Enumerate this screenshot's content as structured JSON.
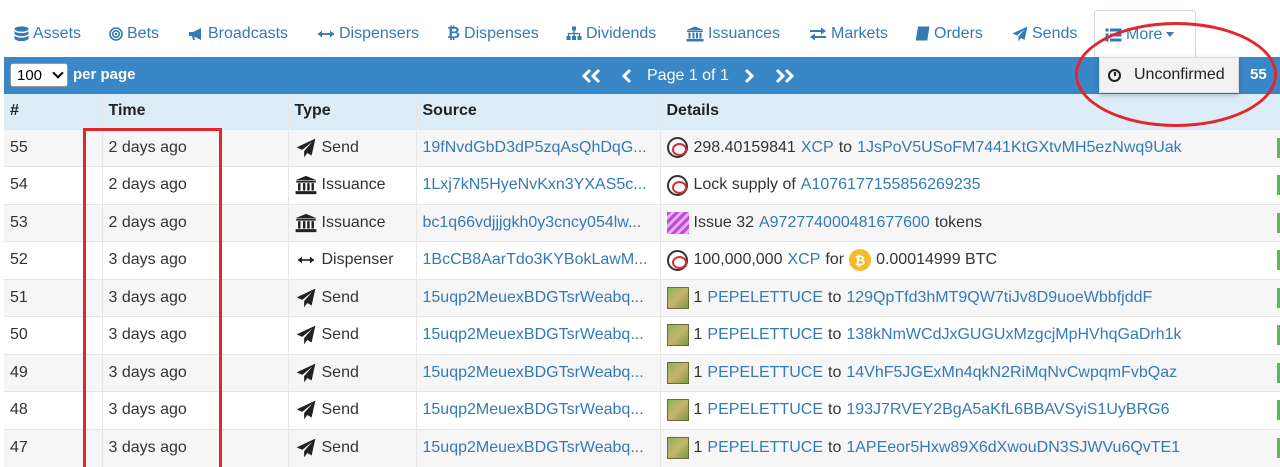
{
  "nav": {
    "items": [
      {
        "label": "Assets",
        "icon": "database-icon"
      },
      {
        "label": "Bets",
        "icon": "bullseye-icon"
      },
      {
        "label": "Broadcasts",
        "icon": "bullhorn-icon"
      },
      {
        "label": "Dispensers",
        "icon": "arrows-h-icon"
      },
      {
        "label": "Dispenses",
        "icon": "bitcoin-icon"
      },
      {
        "label": "Dividends",
        "icon": "sitemap-icon"
      },
      {
        "label": "Issuances",
        "icon": "bank-icon"
      },
      {
        "label": "Markets",
        "icon": "exchange-icon"
      },
      {
        "label": "Orders",
        "icon": "book-icon"
      },
      {
        "label": "Sends",
        "icon": "paper-plane-icon"
      },
      {
        "label": "More",
        "icon": "list-icon"
      }
    ]
  },
  "toolbar": {
    "per_page_value": "100",
    "per_page_label": "per page",
    "page_text": "Page 1 of 1",
    "count": "55"
  },
  "dropdown": {
    "item": "Unconfirmed",
    "icon": "clock-icon"
  },
  "table": {
    "headers": [
      "#",
      "Time",
      "Type",
      "Source",
      "Details"
    ],
    "rows": [
      {
        "n": "55",
        "time": "2 days ago",
        "type": "Send",
        "type_icon": "paper-plane-icon",
        "source": "19fNvdGbD3dP5zqAsQhDqG...",
        "icon": "xcp",
        "pre": "298.40159841",
        "asset": "XCP",
        "mid": "to",
        "link2": "1JsPoV5USoFM7441KtGXtvMH5ezNwq9Uak",
        "post": ""
      },
      {
        "n": "54",
        "time": "2 days ago",
        "type": "Issuance",
        "type_icon": "bank-icon",
        "source": "1Lxj7kN5HyeNvKxn3YXAS5c...",
        "icon": "xcp",
        "pre": "Lock supply of",
        "asset": "A1076177155856269235",
        "mid": "",
        "link2": "",
        "post": ""
      },
      {
        "n": "53",
        "time": "2 days ago",
        "type": "Issuance",
        "type_icon": "bank-icon",
        "source": "bc1q66vdjjjgkh0y3cncy054lw...",
        "icon": "issue",
        "pre": "Issue 32",
        "asset": "A972774000481677600",
        "mid": "",
        "link2": "",
        "post": "tokens"
      },
      {
        "n": "52",
        "time": "3 days ago",
        "type": "Dispenser",
        "type_icon": "arrows-h-icon",
        "source": "1BcCB8AarTdo3KYBokLawM...",
        "icon": "xcp",
        "pre": "100,000,000",
        "asset": "XCP",
        "mid": "for",
        "link2": "",
        "post": "0.00014999 BTC",
        "btc": true
      },
      {
        "n": "51",
        "time": "3 days ago",
        "type": "Send",
        "type_icon": "paper-plane-icon",
        "source": "15uqp2MeuexBDGTsrWeabq...",
        "icon": "pepe",
        "pre": "1",
        "asset": "PEPELETTUCE",
        "mid": "to",
        "link2": "129QpTfd3hMT9QW7tiJv8D9uoeWbbfjddF",
        "post": ""
      },
      {
        "n": "50",
        "time": "3 days ago",
        "type": "Send",
        "type_icon": "paper-plane-icon",
        "source": "15uqp2MeuexBDGTsrWeabq...",
        "icon": "pepe",
        "pre": "1",
        "asset": "PEPELETTUCE",
        "mid": "to",
        "link2": "138kNmWCdJxGUGUxMzgcjMpHVhqGaDrh1k",
        "post": ""
      },
      {
        "n": "49",
        "time": "3 days ago",
        "type": "Send",
        "type_icon": "paper-plane-icon",
        "source": "15uqp2MeuexBDGTsrWeabq...",
        "icon": "pepe",
        "pre": "1",
        "asset": "PEPELETTUCE",
        "mid": "to",
        "link2": "14VhF5JGExMn4qkN2RiMqNvCwpqmFvbQaz",
        "post": ""
      },
      {
        "n": "48",
        "time": "3 days ago",
        "type": "Send",
        "type_icon": "paper-plane-icon",
        "source": "15uqp2MeuexBDGTsrWeabq...",
        "icon": "pepe",
        "pre": "1",
        "asset": "PEPELETTUCE",
        "mid": "to",
        "link2": "193J7RVEY2BgA5aKfL6BBAVSyiS1UyBRG6",
        "post": ""
      },
      {
        "n": "47",
        "time": "3 days ago",
        "type": "Send",
        "type_icon": "paper-plane-icon",
        "source": "15uqp2MeuexBDGTsrWeabq...",
        "icon": "pepe",
        "pre": "1",
        "asset": "PEPELETTUCE",
        "mid": "to",
        "link2": "1APEeor5Hxw89X6dXwouDN3SJWVu6QvTE1",
        "post": ""
      }
    ]
  },
  "colors": {
    "link": "#337ab7",
    "toolbar": "#3a87c8",
    "header_row": "#dcedf8",
    "annotation": "#e2262b"
  }
}
